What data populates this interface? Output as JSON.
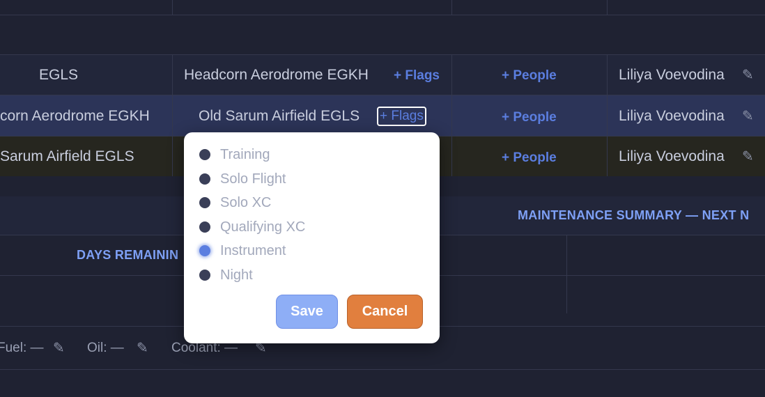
{
  "rows": [
    {
      "col1": "EGLS",
      "col2": "Headcorn Aerodrome EGKH",
      "flags": "+ Flags",
      "people": "+ People",
      "pilot": "Liliya Voevodina"
    },
    {
      "col1": "corn Aerodrome EGKH",
      "col2": "Old Sarum Airfield EGLS",
      "flags": "+ Flags",
      "people": "+ People",
      "pilot": "Liliya Voevodina"
    },
    {
      "col1": "Sarum Airfield EGLS",
      "people": "+ People",
      "pilot": "Liliya Voevodina"
    }
  ],
  "maintenance": {
    "title": "MAINTENANCE SUMMARY — NEXT N",
    "days_remaining": "DAYS REMAININ"
  },
  "fluids": {
    "fuel": "Fuel: —",
    "oil": "Oil: —",
    "coolant": "Coolant: —"
  },
  "flags_popup": {
    "options": [
      "Training",
      "Solo Flight",
      "Solo XC",
      "Qualifying XC",
      "Instrument",
      "Night"
    ],
    "active_option": "Instrument",
    "save_label": "Save",
    "cancel_label": "Cancel"
  },
  "colors": {
    "background": "#1f2232",
    "selected_row": "#2c3458",
    "highlight_row": "#26261f",
    "accent": "#5b7ee0",
    "cancel": "#e17f3e"
  }
}
